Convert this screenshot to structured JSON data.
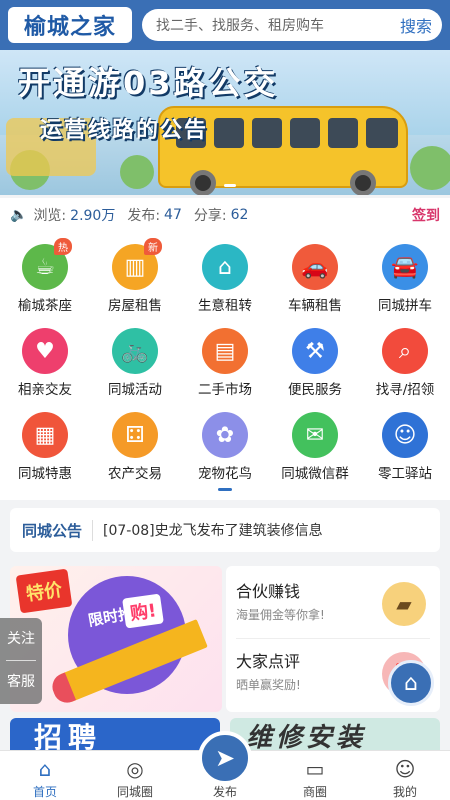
{
  "header": {
    "logo_text": "榆城之家",
    "search_placeholder": "找二手、找服务、租房购车",
    "search_button": "搜索"
  },
  "banner": {
    "title": "开通游03路公交",
    "subtitle": "运营线路的公告"
  },
  "stats": {
    "views_label": "浏览:",
    "views_value": "2.90万",
    "posts_label": "发布:",
    "posts_value": "47",
    "shares_label": "分享:",
    "shares_value": "62",
    "signin": "签到"
  },
  "grid": [
    {
      "label": "榆城茶座",
      "icon": "tea-cup-icon",
      "color": "#5db84a",
      "glyph": "☕",
      "tag": "热"
    },
    {
      "label": "房屋租售",
      "icon": "building-icon",
      "color": "#f5a524",
      "glyph": "▥",
      "tag": "新"
    },
    {
      "label": "生意租转",
      "icon": "shop-icon",
      "color": "#2bb7c4",
      "glyph": "⌂",
      "tag": ""
    },
    {
      "label": "车辆租售",
      "icon": "car-icon",
      "color": "#f05a3b",
      "glyph": "🚗",
      "tag": ""
    },
    {
      "label": "同城拼车",
      "icon": "carpool-icon",
      "color": "#3a8fe6",
      "glyph": "🚘",
      "tag": ""
    },
    {
      "label": "相亲交友",
      "icon": "heart-pin-icon",
      "color": "#ee3f6d",
      "glyph": "♥",
      "tag": ""
    },
    {
      "label": "同城活动",
      "icon": "bicycle-icon",
      "color": "#2fc0a4",
      "glyph": "🚲",
      "tag": ""
    },
    {
      "label": "二手市场",
      "icon": "market-icon",
      "color": "#f27031",
      "glyph": "▤",
      "tag": ""
    },
    {
      "label": "便民服务",
      "icon": "broom-icon",
      "color": "#3f7fe8",
      "glyph": "⚒",
      "tag": ""
    },
    {
      "label": "找寻/招领",
      "icon": "magnifier-icon",
      "color": "#f24b3c",
      "glyph": "⌕",
      "tag": ""
    },
    {
      "label": "同城特惠",
      "icon": "discount-icon",
      "color": "#f0553a",
      "glyph": "▦",
      "tag": ""
    },
    {
      "label": "农产交易",
      "icon": "basket-icon",
      "color": "#f59a27",
      "glyph": "⚃",
      "tag": ""
    },
    {
      "label": "宠物花鸟",
      "icon": "paw-icon",
      "color": "#8c8fe8",
      "glyph": "✿",
      "tag": ""
    },
    {
      "label": "同城微信群",
      "icon": "wechat-icon",
      "color": "#43c15d",
      "glyph": "✉",
      "tag": ""
    },
    {
      "label": "零工驿站",
      "icon": "worker-icon",
      "color": "#2f72d6",
      "glyph": "☺",
      "tag": ""
    }
  ],
  "notice": {
    "title": "同城公告",
    "text": "[07-08]史龙飞发布了建筑装修信息"
  },
  "promo": {
    "badge": "特价",
    "limited": "限时抢",
    "buy": "购!",
    "items": [
      {
        "title": "合伙赚钱",
        "sub": "海量佣金等你拿!",
        "icon": "wallet-icon",
        "glyph": "▰"
      },
      {
        "title": "大家点评",
        "sub": "晒单赢奖励!",
        "icon": "gift-icon",
        "glyph": "🎁"
      }
    ]
  },
  "bottom_banners": {
    "left": "招聘",
    "right": "维修安装"
  },
  "side": {
    "follow": "关注",
    "service": "客服"
  },
  "tabbar": [
    {
      "label": "首页",
      "icon": "home-icon",
      "glyph": "⌂",
      "active": true
    },
    {
      "label": "同城圈",
      "icon": "circle-community-icon",
      "glyph": "◎",
      "active": false
    },
    {
      "label": "发布",
      "icon": "send-icon",
      "glyph": "➤",
      "active": false
    },
    {
      "label": "商圈",
      "icon": "store-icon",
      "glyph": "▭",
      "active": false
    },
    {
      "label": "我的",
      "icon": "smile-icon",
      "glyph": "☺",
      "active": false
    }
  ]
}
